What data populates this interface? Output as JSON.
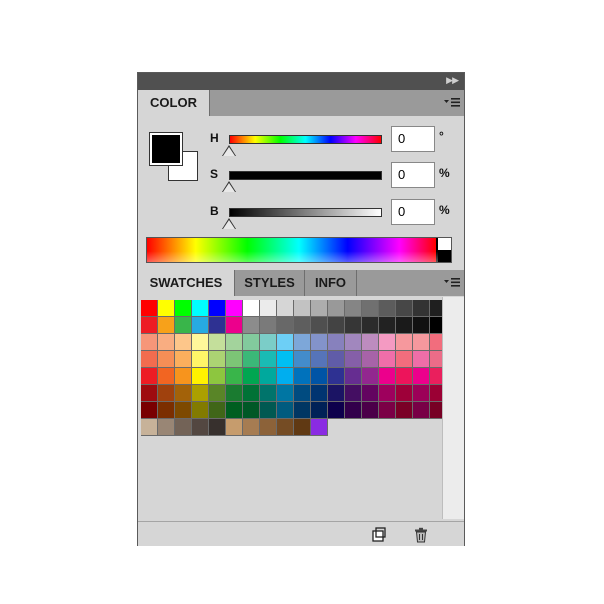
{
  "color_panel": {
    "tab_label": "COLOR",
    "foreground_color": "#000000",
    "background_color": "#ffffff",
    "sliders": [
      {
        "label": "H",
        "value": "0",
        "unit": "°"
      },
      {
        "label": "S",
        "value": "0",
        "unit": "%"
      },
      {
        "label": "B",
        "value": "0",
        "unit": "%"
      }
    ]
  },
  "swatches_panel": {
    "tabs": [
      {
        "label": "SWATCHES",
        "active": true
      },
      {
        "label": "STYLES",
        "active": false
      },
      {
        "label": "INFO",
        "active": false
      }
    ],
    "rows": [
      [
        "#ff0000",
        "#ffff00",
        "#00ff00",
        "#00ffff",
        "#0000ff",
        "#ff00ff",
        "#ffffff",
        "#ebebeb",
        "#d6d6d6",
        "#c2c2c2",
        "#adadad",
        "#999999",
        "#858585",
        "#707070",
        "#5c5c5c",
        "#474747",
        "#333333",
        "#1f1f1f"
      ],
      [
        "#ed1c24",
        "#f7a11a",
        "#39b54a",
        "#27aae1",
        "#2e3192",
        "#ec008c",
        "#8c8c8c",
        "#7a7a7a",
        "#686868",
        "#5e5e5e",
        "#4f4f4f",
        "#434343",
        "#363636",
        "#2b2b2b",
        "#222222",
        "#1a1a1a",
        "#111111",
        "#000000"
      ],
      [
        "#f69679",
        "#f9ad81",
        "#fdc68a",
        "#fff79a",
        "#c4df9b",
        "#a3d39c",
        "#82ca9d",
        "#7bcdc8",
        "#6dcff6",
        "#7da7d9",
        "#8393ca",
        "#8781bd",
        "#a187be",
        "#bd8cbf",
        "#f49ac2",
        "#f6989d",
        "#f5989d",
        "#f26d7d"
      ],
      [
        "#f26c4f",
        "#f68e56",
        "#fbaf5d",
        "#fff568",
        "#acd373",
        "#7cc576",
        "#3bb878",
        "#1abbb4",
        "#00bff3",
        "#438ccb",
        "#5674b9",
        "#605ca8",
        "#855fa8",
        "#a763a8",
        "#f06ea9",
        "#f26d7d",
        "#ef6ea8",
        "#ec6c88"
      ],
      [
        "#ed1c24",
        "#f26522",
        "#f7941d",
        "#fff200",
        "#8dc63f",
        "#39b54a",
        "#00a651",
        "#00a99d",
        "#00aeef",
        "#0072bc",
        "#0054a6",
        "#2e3192",
        "#662d91",
        "#92278f",
        "#ec008c",
        "#ed145b",
        "#ec008c",
        "#ea1f5d"
      ],
      [
        "#9e0b0f",
        "#a0410d",
        "#a36209",
        "#aba000",
        "#598527",
        "#1a7b30",
        "#007236",
        "#00746b",
        "#0076a3",
        "#004b80",
        "#003471",
        "#1b1464",
        "#440e62",
        "#630460",
        "#9e005d",
        "#9e0039",
        "#9c0058",
        "#9b0034"
      ],
      [
        "#790000",
        "#7b2e00",
        "#7d4900",
        "#827b00",
        "#406618",
        "#005e20",
        "#005826",
        "#005952",
        "#005b7f",
        "#003663",
        "#002157",
        "#0d004c",
        "#32004b",
        "#4b0049",
        "#7b0046",
        "#7a0026",
        "#780046",
        "#770024"
      ],
      [
        "#c7b299",
        "#998675",
        "#736357",
        "#534741",
        "#37302d",
        "#c69c6d",
        "#a67c52",
        "#8c6239",
        "#754c24",
        "#603913",
        "#8a2be2"
      ]
    ]
  },
  "bottom_bar": {
    "new_swatch_icon": "new-swatch-icon",
    "delete_swatch_icon": "trash-icon"
  }
}
